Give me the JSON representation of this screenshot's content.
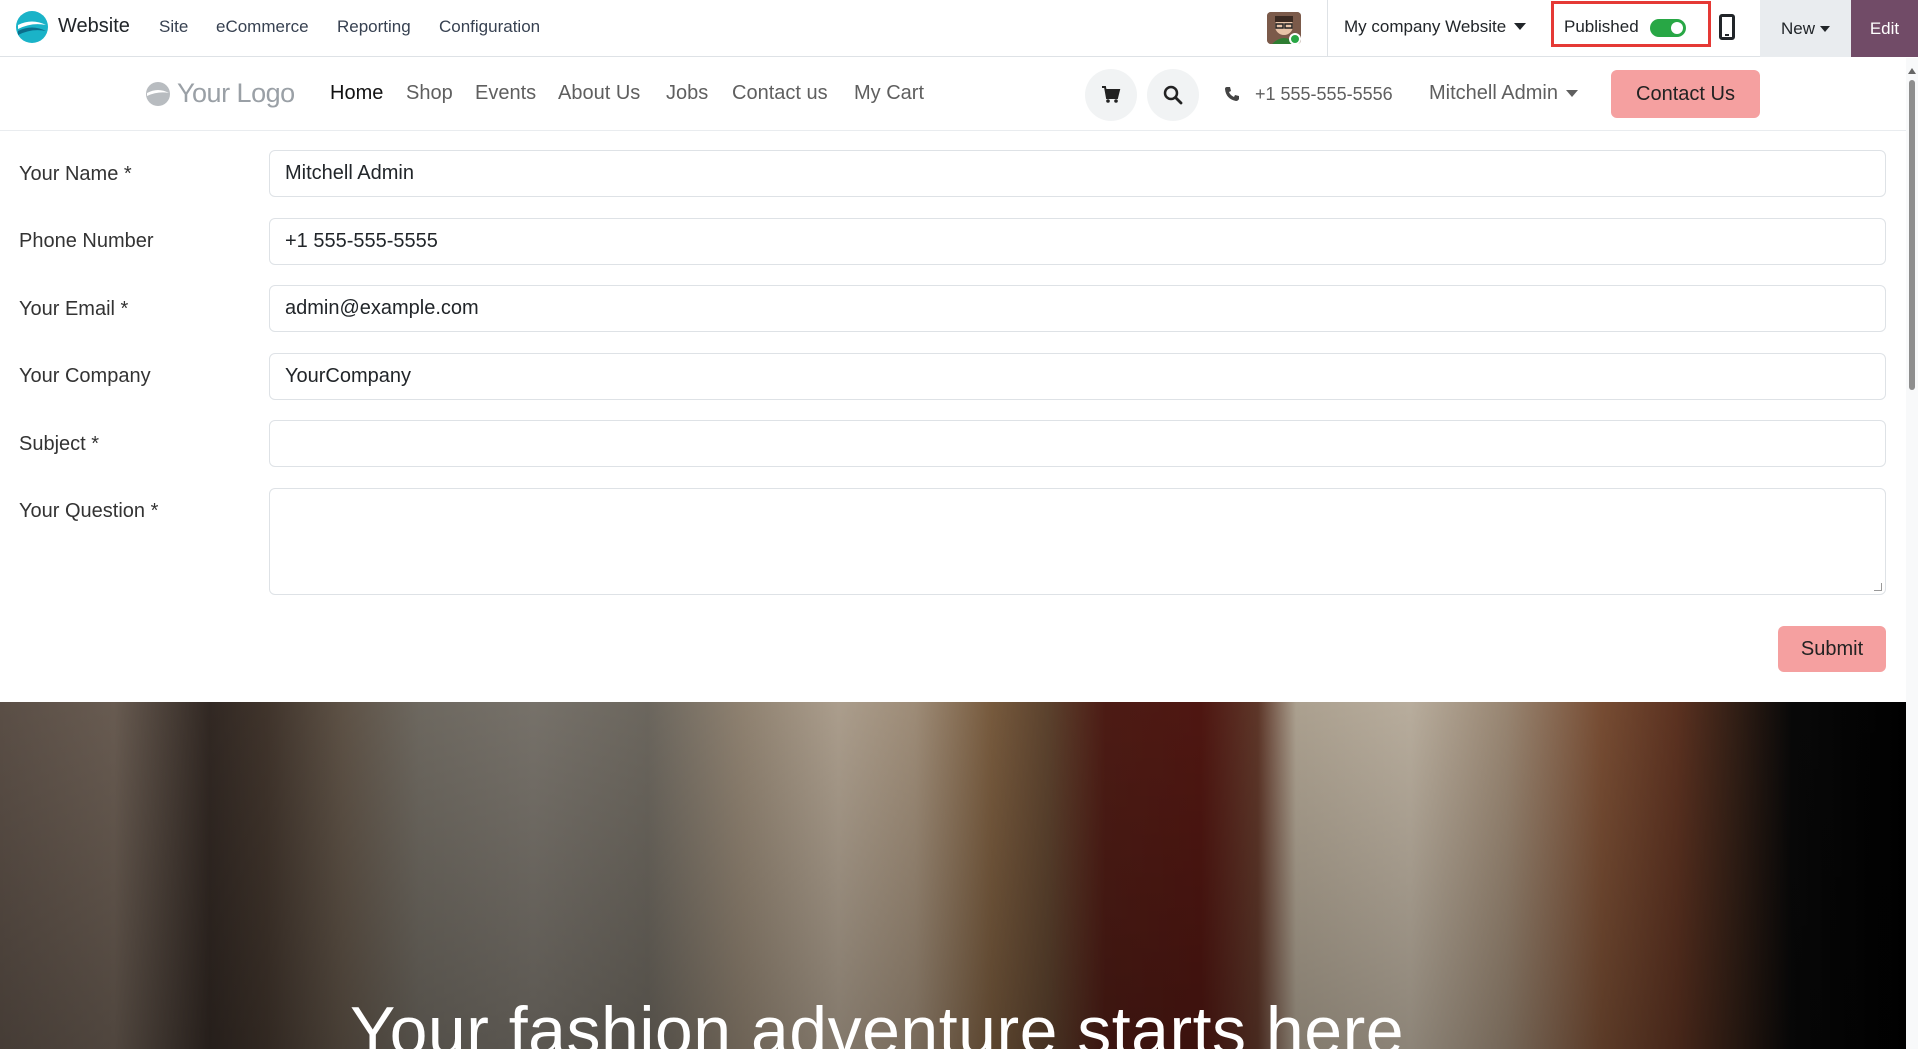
{
  "topbar": {
    "app_name": "Website",
    "menu": [
      "Site",
      "eCommerce",
      "Reporting",
      "Configuration"
    ],
    "website_selector": "My company Website",
    "published_label": "Published",
    "published_state": true,
    "new_label": "New",
    "edit_label": "Edit",
    "colors": {
      "edit_bg": "#714b67",
      "toggle_on": "#28a745",
      "highlight_box": "#e53935"
    }
  },
  "site_header": {
    "logo_text": "Your Logo",
    "nav": [
      "Home",
      "Shop",
      "Events",
      "About Us",
      "Jobs",
      "Contact us",
      "My Cart"
    ],
    "active_nav": "Home",
    "phone": "+1 555-555-5556",
    "user": "Mitchell Admin",
    "contact_button": "Contact Us",
    "icons": [
      "shopping-cart-icon",
      "search-icon",
      "phone-icon"
    ]
  },
  "form": {
    "fields": [
      {
        "label": "Your Name *",
        "value": "Mitchell Admin"
      },
      {
        "label": "Phone Number",
        "value": "+1 555-555-5555"
      },
      {
        "label": "Your Email *",
        "value": "admin@example.com"
      },
      {
        "label": "Your Company",
        "value": "YourCompany"
      },
      {
        "label": "Subject *",
        "value": ""
      },
      {
        "label": "Your Question *",
        "value": ""
      }
    ],
    "submit_label": "Submit",
    "button_color": "#f5a0a0"
  },
  "hero": {
    "title": "Your fashion adventure starts here"
  }
}
